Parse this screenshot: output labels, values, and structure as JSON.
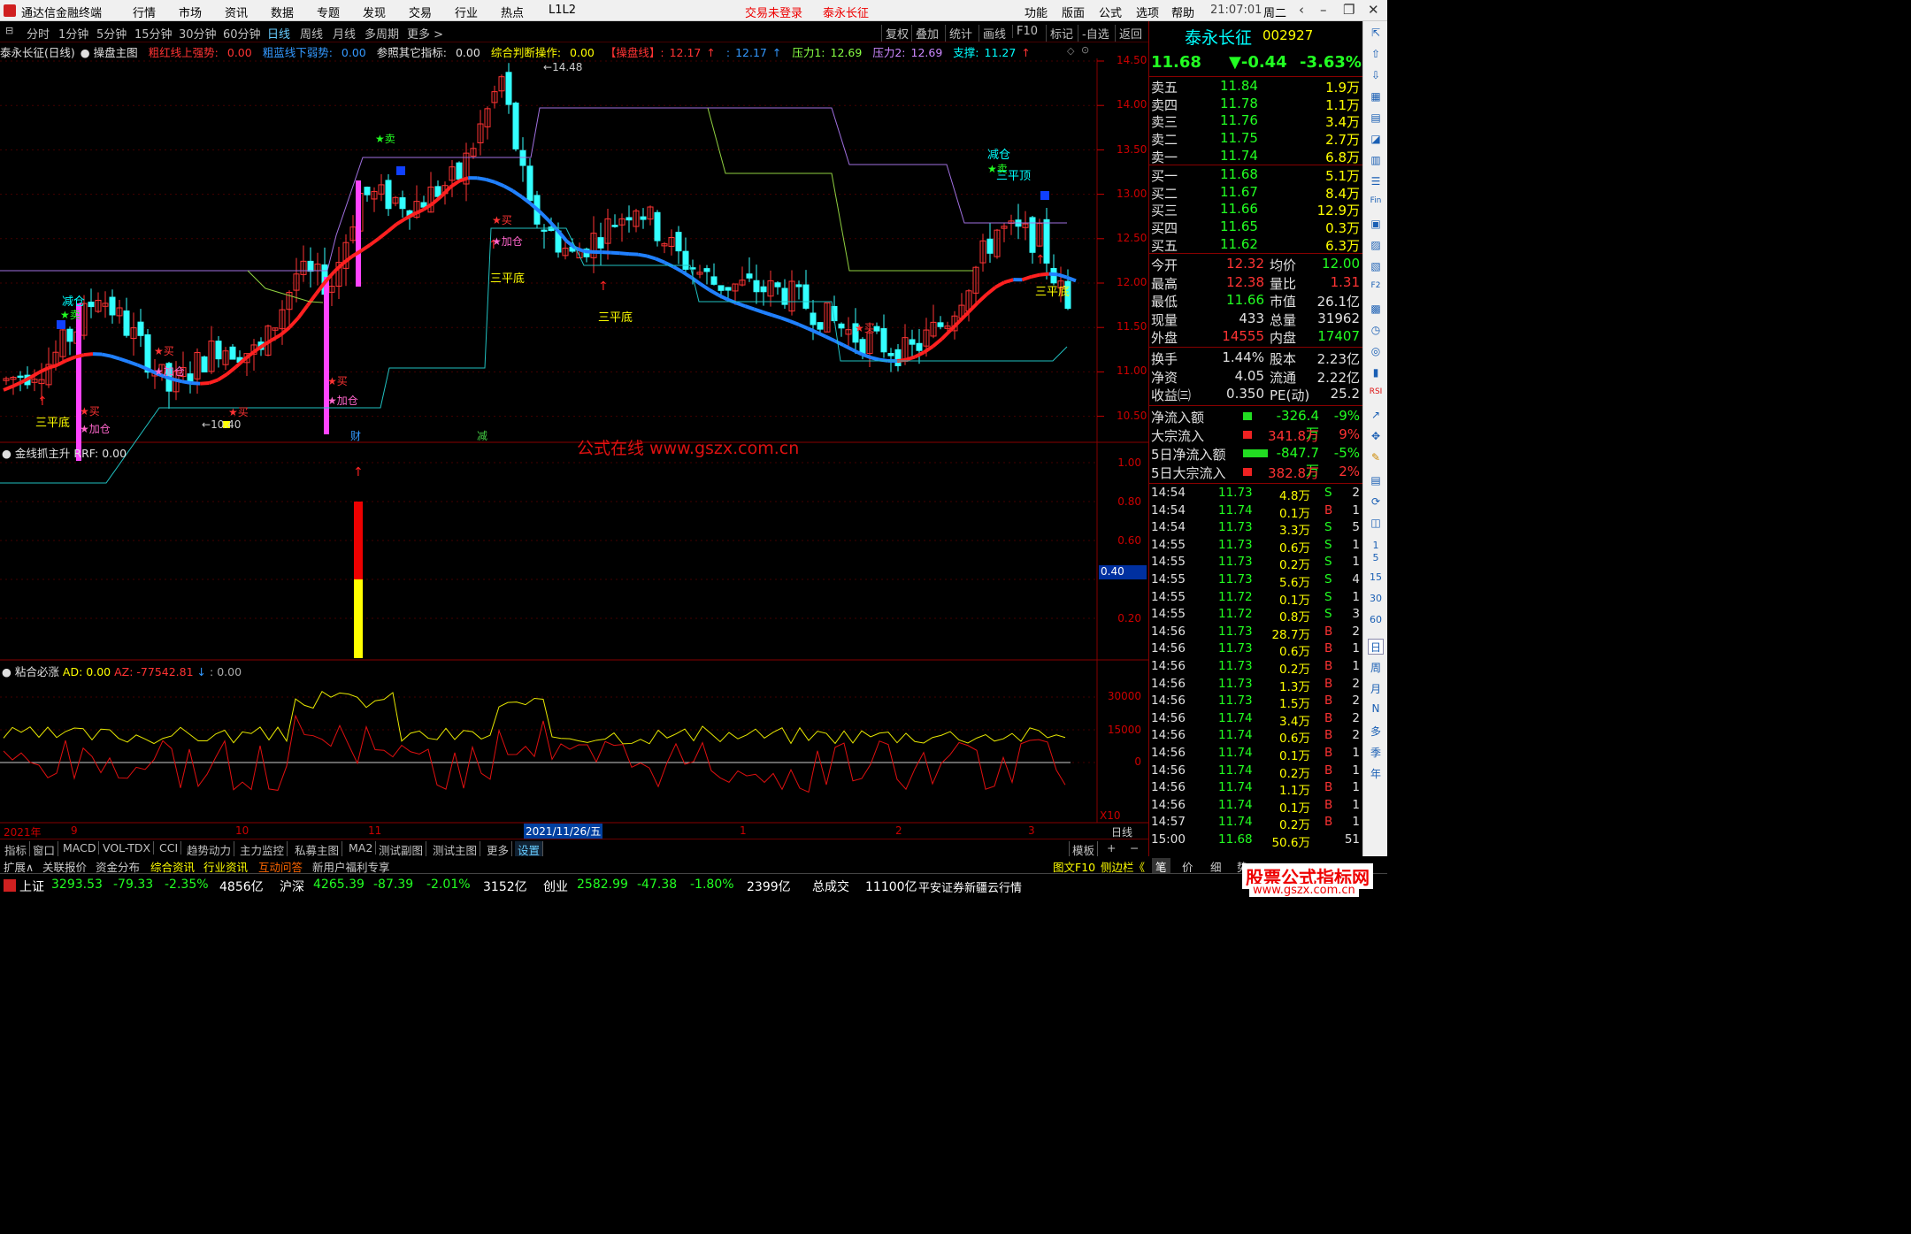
{
  "app": {
    "title": "通达信金融终端",
    "menus": [
      "行情",
      "市场",
      "资讯",
      "数据",
      "专题",
      "发现",
      "交易",
      "行业",
      "热点",
      "L1L2"
    ],
    "login": "交易未登录",
    "stock_title": "泰永长征",
    "right_menus": [
      "功能",
      "版面",
      "公式",
      "选项",
      "帮助"
    ],
    "clock": "21:07:01",
    "weekday": "周二"
  },
  "tabs": {
    "periods": [
      "分时",
      "1分钟",
      "5分钟",
      "15分钟",
      "30分钟",
      "60分钟",
      "日线",
      "周线",
      "月线",
      "多周期",
      "更多 >"
    ],
    "active": "日线",
    "tools": [
      "复权",
      "叠加",
      "统计",
      "画线",
      "F10",
      "标记",
      "-自选",
      "返回"
    ]
  },
  "main_chart": {
    "title": "泰永长征(日线)",
    "formula": "操盘主图",
    "indicators": [
      {
        "label": "粗红线上强势:",
        "value": "0.00",
        "color": "#f33"
      },
      {
        "label": "粗蓝线下弱势:",
        "value": "0.00",
        "color": "#39f"
      },
      {
        "label": "参照其它指标:",
        "value": "0.00",
        "color": "#e0e0e0"
      },
      {
        "label": "综合判断操作:",
        "value": "0.00",
        "color": "#ff0"
      },
      {
        "label": "【操盘线】:",
        "value": "12.17",
        "color": "#f33",
        "arrow": "↑"
      },
      {
        "label": ":",
        "value": "12.17",
        "color": "#39f",
        "arrow": "↑"
      },
      {
        "label": "压力1:",
        "value": "12.69",
        "color": "#8f4"
      },
      {
        "label": "压力2:",
        "value": "12.69",
        "color": "#c8f"
      },
      {
        "label": "支撑:",
        "value": "11.27",
        "color": "#0ff",
        "arrow": "↑"
      }
    ],
    "y_ticks": [
      "14.50",
      "14.00",
      "13.50",
      "13.00",
      "12.50",
      "12.00",
      "11.50",
      "11.00",
      "10.50"
    ],
    "peak_label": "14.48",
    "low_label": "10.40",
    "annotations": [
      {
        "text": "三平底",
        "color": "#ff0",
        "at": "left-bottom"
      },
      {
        "text": "三平底",
        "color": "#ff0",
        "at": "mid-upper"
      },
      {
        "text": "三平底",
        "color": "#ff0",
        "at": "mid-lower"
      },
      {
        "text": "三平底",
        "color": "#ff0",
        "at": "right"
      },
      {
        "text": "三平顶",
        "color": "#0ff",
        "at": "right-top"
      },
      {
        "text": "减仓",
        "color": "#0ff",
        "at": "left"
      },
      {
        "text": "减仓",
        "color": "#0ff",
        "at": "right"
      },
      {
        "text": "★卖",
        "color": "#0f0",
        "at": "left"
      },
      {
        "text": "★卖",
        "color": "#0f0",
        "at": "upper"
      },
      {
        "text": "★卖",
        "color": "#0f0",
        "at": "right"
      },
      {
        "text": "★买",
        "color": "#f33",
        "at": "various"
      },
      {
        "text": "★加仓",
        "color": "#f6c",
        "at": "various"
      }
    ],
    "markers": [
      "财",
      "减"
    ],
    "watermark": "公式在线 www.gszx.com.cn"
  },
  "sub1": {
    "name": "金线抓主升",
    "indicator": "RRF:",
    "value": "0.00",
    "y_ticks": [
      "1.00",
      "0.80",
      "0.60",
      "0.40",
      "0.20"
    ],
    "cursor_value": "0.40"
  },
  "sub2": {
    "name": "粘合必涨",
    "ad_label": "AD:",
    "ad_value": "0.00",
    "az_label": "AZ:",
    "az_value": "-77542.81",
    "extra": ": 0.00",
    "y_ticks": [
      "30000",
      "15000",
      "0"
    ],
    "x10": "X10"
  },
  "time_axis": {
    "labels": [
      "2021年",
      "9",
      "10",
      "11",
      "2021/11/26/五",
      "1",
      "2",
      "3"
    ],
    "period": "日线"
  },
  "bottom_tabs": [
    "指标",
    "窗口",
    "MACD",
    "VOL-TDX",
    "CCI",
    "趋势动力",
    "主力监控",
    "私募主图",
    "MA2",
    "测试副图",
    "测试主图",
    "更多",
    "设置"
  ],
  "bottom_right": [
    "模板",
    "+",
    "−"
  ],
  "ext_bar": [
    "扩展∧",
    "关联报价",
    "资金分布",
    "综合资讯",
    "行业资讯",
    "互动问答",
    "新用户福利专享"
  ],
  "ext_right": [
    "图文F10",
    "侧边栏《"
  ],
  "status": {
    "sh": {
      "name": "上证",
      "value": "3293.53",
      "chg": "-79.33",
      "pct": "-2.35%",
      "amt": "4856亿"
    },
    "sz": {
      "name": "沪深",
      "value": "4265.39",
      "chg": "-87.39",
      "pct": "-2.01%",
      "amt": "3152亿"
    },
    "cy": {
      "name": "创业",
      "value": "2582.99",
      "chg": "-47.38",
      "pct": "-1.80%",
      "amt": "2399亿"
    },
    "total_label": "总成交",
    "total": "11100亿",
    "broker": "平安证券新疆云行情"
  },
  "quote": {
    "name": "泰永长征",
    "code": "002927",
    "price": "11.68",
    "change": "▼-0.44",
    "pct": "-3.63%",
    "asks": [
      {
        "label": "卖五",
        "p": "11.84",
        "v": "1.9万"
      },
      {
        "label": "卖四",
        "p": "11.78",
        "v": "1.1万"
      },
      {
        "label": "卖三",
        "p": "11.76",
        "v": "3.4万"
      },
      {
        "label": "卖二",
        "p": "11.75",
        "v": "2.7万"
      },
      {
        "label": "卖一",
        "p": "11.74",
        "v": "6.8万"
      }
    ],
    "bids": [
      {
        "label": "买一",
        "p": "11.68",
        "v": "5.1万"
      },
      {
        "label": "买二",
        "p": "11.67",
        "v": "8.4万"
      },
      {
        "label": "买三",
        "p": "11.66",
        "v": "12.9万"
      },
      {
        "label": "买四",
        "p": "11.65",
        "v": "0.3万"
      },
      {
        "label": "买五",
        "p": "11.62",
        "v": "6.3万"
      }
    ],
    "stats": [
      {
        "l1": "今开",
        "v1": "12.32",
        "l2": "均价",
        "v2": "12.00"
      },
      {
        "l1": "最高",
        "v1": "12.38",
        "l2": "量比",
        "v2": "1.31"
      },
      {
        "l1": "最低",
        "v1": "11.66",
        "l2": "市值",
        "v2": "26.1亿"
      },
      {
        "l1": "现量",
        "v1": "433",
        "l2": "总量",
        "v2": "31962"
      },
      {
        "l1": "外盘",
        "v1": "14555",
        "l2": "内盘",
        "v2": "17407"
      }
    ],
    "stats2": [
      {
        "l1": "换手",
        "v1": "1.44%",
        "l2": "股本",
        "v2": "2.23亿"
      },
      {
        "l1": "净资",
        "v1": "4.05",
        "l2": "流通",
        "v2": "2.22亿"
      },
      {
        "l1": "收益㈢",
        "v1": "0.350",
        "l2": "PE(动)",
        "v2": "25.2"
      }
    ],
    "flows": [
      {
        "label": "净流入额",
        "value": "-326.4万",
        "pct": "-9%",
        "up": false
      },
      {
        "label": "大宗流入",
        "value": "341.8万",
        "pct": "9%",
        "up": true
      },
      {
        "label": "5日净流入额",
        "value": "-847.7万",
        "pct": "-5%",
        "up": false
      },
      {
        "label": "5日大宗流入",
        "value": "382.8万",
        "pct": "2%",
        "up": true
      }
    ],
    "trades": [
      {
        "t": "14:54",
        "p": "11.73",
        "v": "4.8万",
        "s": "S",
        "n": "2"
      },
      {
        "t": "14:54",
        "p": "11.74",
        "v": "0.1万",
        "s": "B",
        "n": "1"
      },
      {
        "t": "14:54",
        "p": "11.73",
        "v": "3.3万",
        "s": "S",
        "n": "5"
      },
      {
        "t": "14:55",
        "p": "11.73",
        "v": "0.6万",
        "s": "S",
        "n": "1"
      },
      {
        "t": "14:55",
        "p": "11.73",
        "v": "0.2万",
        "s": "S",
        "n": "1"
      },
      {
        "t": "14:55",
        "p": "11.73",
        "v": "5.6万",
        "s": "S",
        "n": "4"
      },
      {
        "t": "14:55",
        "p": "11.72",
        "v": "0.1万",
        "s": "S",
        "n": "1"
      },
      {
        "t": "14:55",
        "p": "11.72",
        "v": "0.8万",
        "s": "S",
        "n": "3"
      },
      {
        "t": "14:56",
        "p": "11.73",
        "v": "28.7万",
        "s": "B",
        "n": "2"
      },
      {
        "t": "14:56",
        "p": "11.73",
        "v": "0.6万",
        "s": "B",
        "n": "1"
      },
      {
        "t": "14:56",
        "p": "11.73",
        "v": "0.2万",
        "s": "B",
        "n": "1"
      },
      {
        "t": "14:56",
        "p": "11.73",
        "v": "1.3万",
        "s": "B",
        "n": "2"
      },
      {
        "t": "14:56",
        "p": "11.73",
        "v": "1.5万",
        "s": "B",
        "n": "2"
      },
      {
        "t": "14:56",
        "p": "11.74",
        "v": "3.4万",
        "s": "B",
        "n": "2"
      },
      {
        "t": "14:56",
        "p": "11.74",
        "v": "0.6万",
        "s": "B",
        "n": "2"
      },
      {
        "t": "14:56",
        "p": "11.74",
        "v": "0.1万",
        "s": "B",
        "n": "1"
      },
      {
        "t": "14:56",
        "p": "11.74",
        "v": "0.2万",
        "s": "B",
        "n": "1"
      },
      {
        "t": "14:56",
        "p": "11.74",
        "v": "1.1万",
        "s": "B",
        "n": "1"
      },
      {
        "t": "14:56",
        "p": "11.74",
        "v": "0.1万",
        "s": "B",
        "n": "1"
      },
      {
        "t": "14:57",
        "p": "11.74",
        "v": "0.2万",
        "s": "B",
        "n": "1"
      },
      {
        "t": "15:00",
        "p": "11.68",
        "v": "50.6万",
        "s": "",
        "n": "51"
      }
    ],
    "foot_tabs": [
      "笔",
      "价",
      "细",
      "势"
    ]
  },
  "side_strip": [
    "日",
    "周",
    "月",
    "N",
    "多",
    "季",
    "年"
  ],
  "side_strip2": [
    "15",
    "30",
    "60"
  ],
  "watermark_brand": "股票公式指标网",
  "watermark_url": "www.gszx.com.cn"
}
